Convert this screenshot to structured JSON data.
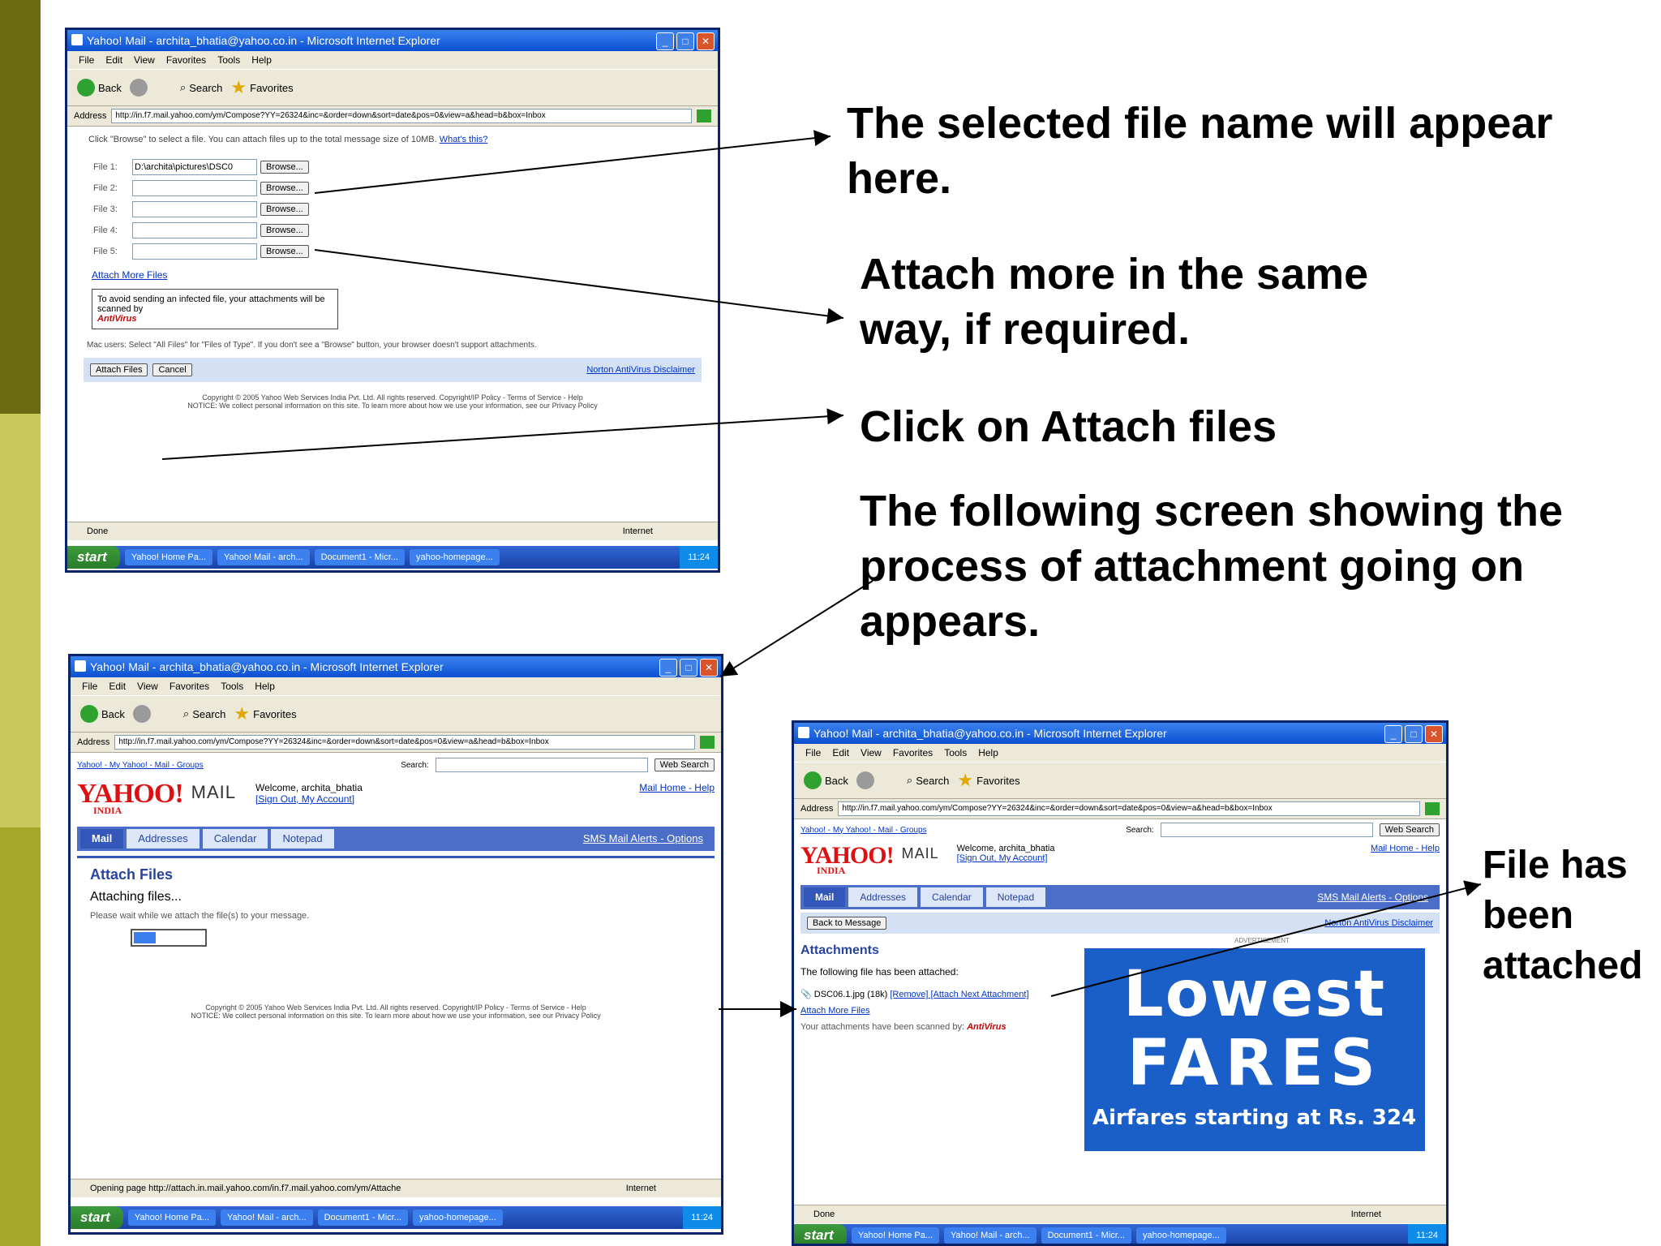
{
  "colors": {
    "strip_dark": "#6b6b12",
    "strip_light": "#c9c85a",
    "arrow": "#000000"
  },
  "window": {
    "title": "Yahoo! Mail - archita_bhatia@yahoo.co.in - Microsoft Internet Explorer",
    "menu": [
      "File",
      "Edit",
      "View",
      "Favorites",
      "Tools",
      "Help"
    ],
    "toolbar": {
      "back": "Back",
      "search": "Search",
      "favorites": "Favorites"
    },
    "address_label": "Address",
    "address_url": "http://in.f7.mail.yahoo.com/ym/Compose?YY=26324&inc=&order=down&sort=date&pos=0&view=a&head=b&box=Inbox",
    "status_done": "Done",
    "status_loading": "Opening page http://attach.in.mail.yahoo.com/in.f7.mail.yahoo.com/ym/Attache",
    "zone": "Internet",
    "taskbar": {
      "start": "start",
      "tasks": [
        "Yahoo! Home Pa...",
        "Yahoo! Mail - arch...",
        "Document1 - Micr...",
        "yahoo-homepage..."
      ],
      "clock": "11:24"
    }
  },
  "shot1": {
    "instruction": "Click \"Browse\" to select a file. You can attach files up to the total message size of 10MB.",
    "whats_this": "What's this?",
    "file_labels": [
      "File 1:",
      "File 2:",
      "File 3:",
      "File 4:",
      "File 5:"
    ],
    "file1_value": "D:\\archita\\pictures\\DSC0",
    "browse_label": "Browse...",
    "attach_link": "Attach More Files",
    "antivirus_notice": "To avoid sending an infected file, your attachments will be scanned by",
    "antivirus_label": "AntiVirus",
    "mac_note": "Mac users: Select \"All Files\" for \"Files of Type\". If you don't see a \"Browse\" button, your browser doesn't support attachments.",
    "attach_button": "Attach Files",
    "cancel_button": "Cancel",
    "norton_link": "Norton AntiVirus Disclaimer",
    "footer1": "Copyright © 2005 Yahoo Web Services India Pvt. Ltd. All rights reserved. Copyright/IP Policy - Terms of Service - Help",
    "footer2": "NOTICE: We collect personal information on this site. To learn more about how we use your information, see our Privacy Policy"
  },
  "shot2": {
    "search_links": "Yahoo! - My Yahoo! - Mail - Groups",
    "search_label": "Search:",
    "search_button": "Web Search",
    "logo": "YAHOO!",
    "logo_sub": "INDIA",
    "mail": "MAIL",
    "welcome": "Welcome, archita_bhatia",
    "welcome_links": "[Sign Out, My Account]",
    "top_right": "Mail Home - Help",
    "tabs": [
      "Mail",
      "Addresses",
      "Calendar",
      "Notepad"
    ],
    "tabs_right": "SMS Mail Alerts - Options",
    "heading": "Attach Files",
    "attaching": "Attaching files...",
    "wait": "Please wait while we attach the file(s) to your message.",
    "progress": 0.3,
    "footer1": "Copyright © 2005 Yahoo Web Services India Pvt. Ltd. All rights reserved. Copyright/IP Policy - Terms of Service - Help",
    "footer2": "NOTICE: We collect personal information on this site. To learn more about how we use your information, see our Privacy Policy"
  },
  "shot3": {
    "back_button": "Back to Message",
    "norton_link": "Norton AntiVirus Disclaimer",
    "heading": "Attachments",
    "attached_notice": "The following file has been attached:",
    "file": "DSC06.1.jpg (18k)",
    "file_links": "[Remove] [Attach Next Attachment]",
    "attach_more": "Attach More Files",
    "scanned_notice": "Your attachments have been scanned by:",
    "antivirus_label": "AntiVirus",
    "ad_label": "ADVERTISEMENT",
    "ad_line1": "Lowest",
    "ad_line2": "FARES",
    "ad_line3": "Airfares starting at Rs. 324",
    "tabs": [
      "Mail",
      "Addresses",
      "Calendar",
      "Notepad"
    ],
    "tabs_right": "SMS Mail Alerts - Options",
    "welcome": "Welcome, archita_bhatia",
    "welcome_links": "[Sign Out, My Account]",
    "top_right": "Mail Home - Help",
    "search_button": "Web Search",
    "search_label": "Search:",
    "search_links": "Yahoo! - My Yahoo! - Mail - Groups"
  },
  "callouts": {
    "c1": "The selected file name will appear here.",
    "c2": "Attach more in the same way, if required.",
    "c3": "Click on Attach files",
    "c4": "The following screen showing the process of attachment going on appears.",
    "c5": "File has been attached"
  }
}
